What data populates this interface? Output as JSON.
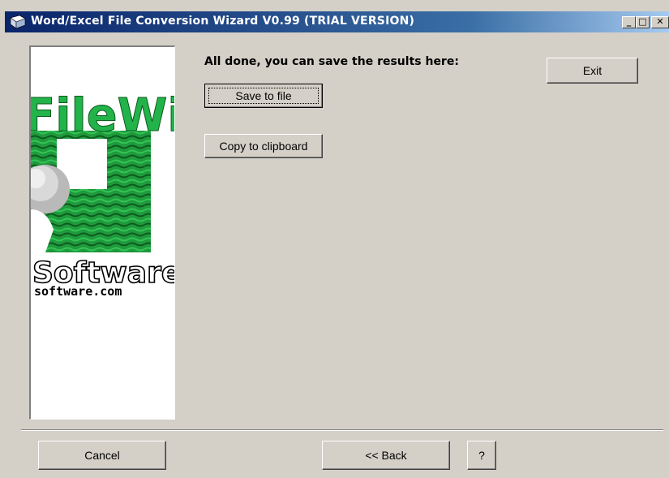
{
  "window": {
    "title": "Word/Excel File Conversion Wizard V0.99 (TRIAL VERSION)",
    "controls": {
      "minimize": "_",
      "maximize": "□",
      "close": "✕"
    }
  },
  "banner": {
    "logo_top": "FileWiz",
    "logo_bottom": "Software",
    "logo_url_text": "software.com"
  },
  "main": {
    "heading": "All done, you can save the results here:",
    "save_button": "Save to file",
    "copy_button": "Copy to clipboard",
    "exit_button": "Exit"
  },
  "footer": {
    "cancel_button": "Cancel",
    "back_button": "<< Back",
    "help_button": "?"
  },
  "colors": {
    "face": "#d4d0c8",
    "titlebar_start": "#0a246a",
    "titlebar_end": "#a6caf0",
    "logo_green": "#22b34a"
  }
}
